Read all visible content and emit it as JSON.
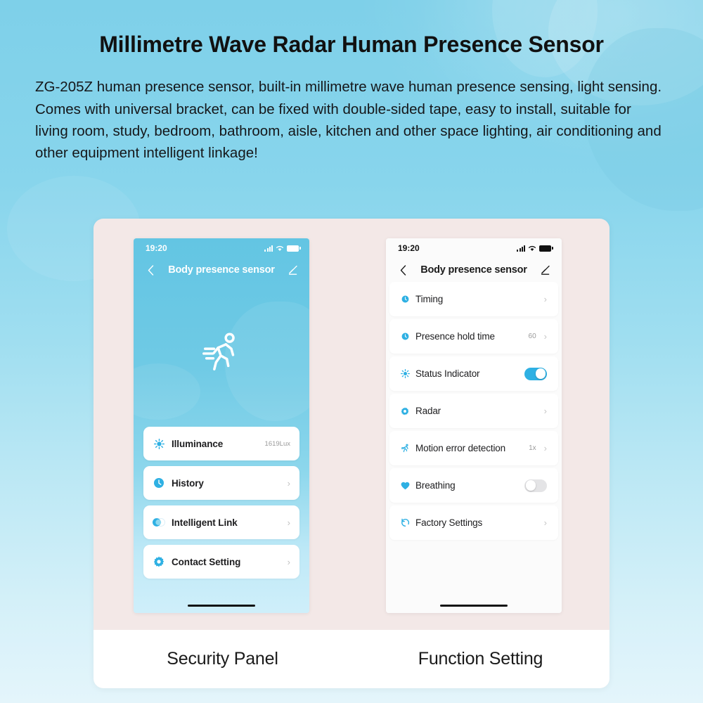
{
  "page": {
    "title": "Millimetre Wave Radar Human Presence Sensor",
    "description": "ZG-205Z human presence sensor, built-in millimetre wave human presence sensing, light sensing. Comes with universal bracket, can be fixed with double-sided tape, easy to install, suitable for living room, study, bedroom, bathroom, aisle, kitchen and other space lighting, air conditioning and other equipment intelligent linkage!"
  },
  "colors": {
    "background_blue": "#78cfe8",
    "card_pink": "#f3e8e7",
    "accent_blue": "#2eb0e3",
    "phone_header_blue": "#63c5e3"
  },
  "captions": {
    "left": "Security Panel",
    "right": "Function Setting"
  },
  "left_phone": {
    "status_bar": {
      "time": "19:20",
      "signal_icon": "signal-bars-icon",
      "wifi_icon": "wifi-icon",
      "battery_icon": "battery-icon"
    },
    "nav": {
      "back_icon": "chevron-left-icon",
      "title": "Body presence sensor",
      "edit_icon": "pencil-edit-icon"
    },
    "hero_icon": "running-person-icon",
    "items": [
      {
        "icon": "sun-brightness-icon",
        "label": "Illuminance",
        "value": "1619Lux",
        "chevron": false
      },
      {
        "icon": "clock-history-icon",
        "label": "History",
        "value": "",
        "chevron": true
      },
      {
        "icon": "toggle-link-icon",
        "label": "Intelligent Link",
        "value": "",
        "chevron": true
      },
      {
        "icon": "gear-settings-icon",
        "label": "Contact Setting",
        "value": "",
        "chevron": true
      }
    ]
  },
  "right_phone": {
    "status_bar": {
      "time": "19:20",
      "signal_icon": "signal-bars-icon",
      "wifi_icon": "wifi-icon",
      "battery_icon": "battery-icon"
    },
    "nav": {
      "back_icon": "chevron-left-icon",
      "title": "Body presence sensor",
      "edit_icon": "pencil-edit-icon"
    },
    "items": [
      {
        "icon": "clock-icon",
        "label": "Timing",
        "value": "",
        "control": "chevron"
      },
      {
        "icon": "clock-icon",
        "label": "Presence hold time",
        "value": "60",
        "control": "chevron"
      },
      {
        "icon": "sun-brightness-icon",
        "label": "Status Indicator",
        "value": "",
        "control": "toggle-on"
      },
      {
        "icon": "gear-settings-icon",
        "label": "Radar",
        "value": "",
        "control": "chevron"
      },
      {
        "icon": "running-person-icon",
        "label": "Motion error detection",
        "value": "1x",
        "control": "chevron"
      },
      {
        "icon": "heart-icon",
        "label": "Breathing",
        "value": "",
        "control": "toggle-off"
      },
      {
        "icon": "restore-arrow-icon",
        "label": "Factory Settings",
        "value": "",
        "control": "chevron"
      }
    ]
  }
}
